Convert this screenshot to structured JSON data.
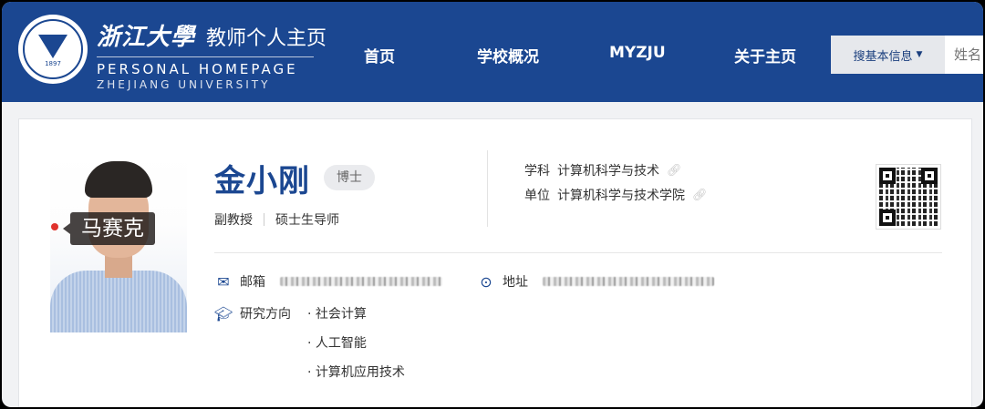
{
  "header": {
    "logo_school_cn": "浙江大學",
    "logo_title_cn": "教师个人主页",
    "logo_en_line1": "PERSONAL HOMEPAGE",
    "logo_en_line2": "ZHEJIANG UNIVERSITY",
    "seal_text": "1897",
    "nav": [
      {
        "label": "首页"
      },
      {
        "label": "学校概况"
      },
      {
        "label": "MYZJU"
      },
      {
        "label": "关于主页"
      }
    ],
    "search_dropdown_label": "搜基本信息",
    "search_placeholder": "姓名",
    "bg_color": "#1b4791"
  },
  "profile": {
    "name_overlay": "马赛克",
    "name": "金小刚",
    "degree": "博士",
    "titles": [
      "副教授",
      "硕士生导师"
    ],
    "subject_label": "学科",
    "subject_value": "计算机科学与技术",
    "unit_label": "单位",
    "unit_value": "计算机科学与技术学院",
    "email_label": "邮箱",
    "address_label": "地址",
    "research_label": "研究方向",
    "research_items": [
      "· 社会计算",
      "· 人工智能",
      "· 计算机应用技术"
    ],
    "accent_color": "#1b4791"
  },
  "icons": {
    "email": "envelope-icon",
    "address": "location-pin-icon",
    "research": "graduation-cap-icon",
    "link": "link-icon",
    "dropdown": "caret-down-icon"
  }
}
